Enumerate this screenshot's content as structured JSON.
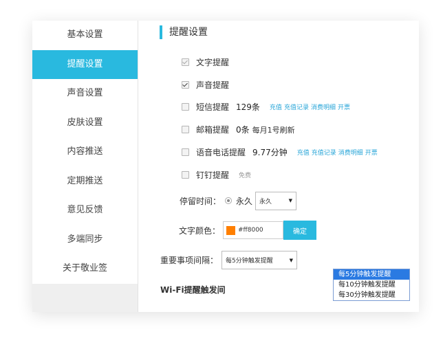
{
  "sidebar": {
    "items": [
      {
        "label": "基本设置"
      },
      {
        "label": "提醒设置"
      },
      {
        "label": "声音设置"
      },
      {
        "label": "皮肤设置"
      },
      {
        "label": "内容推送"
      },
      {
        "label": "定期推送"
      },
      {
        "label": "意见反馈"
      },
      {
        "label": "多端同步"
      },
      {
        "label": "关于敬业签"
      }
    ],
    "active_index": 1
  },
  "main": {
    "title": "提醒设置",
    "options": {
      "text": {
        "label": "文字提醒",
        "checked": true
      },
      "sound": {
        "label": "声音提醒",
        "checked": true
      },
      "sms": {
        "label": "短信提醒",
        "count": "129条",
        "links": [
          "充值",
          "充值记录",
          "消费明细",
          "开票"
        ],
        "checked": false
      },
      "email": {
        "label": "邮箱提醒",
        "count": "0条",
        "note": "每月1号刷新",
        "checked": false
      },
      "voice": {
        "label": "语音电话提醒",
        "count": "9.77分钟",
        "links": [
          "充值",
          "充值记录",
          "消费明细",
          "开票"
        ],
        "checked": false
      },
      "dingtalk": {
        "label": "钉钉提醒",
        "note": "免费",
        "checked": false
      }
    },
    "stay": {
      "label": "停留时间：",
      "radio_label": "永久",
      "select_value": "永久"
    },
    "color": {
      "label": "文字颜色：",
      "value": "#ff8000",
      "swatch": "#ff7f00",
      "confirm": "确定"
    },
    "interval": {
      "label": "重要事项间隔：",
      "selected": "每5分钟触发提醒",
      "options": [
        "每5分钟触发提醒",
        "每10分钟触发提醒",
        "每30分钟触发提醒"
      ]
    },
    "wifi": {
      "label": "Wi-Fi提醒触发间"
    }
  },
  "colors": {
    "accent": "#29b9df",
    "link": "#29a6d8",
    "dropdown_highlight": "#2a7ae2"
  }
}
